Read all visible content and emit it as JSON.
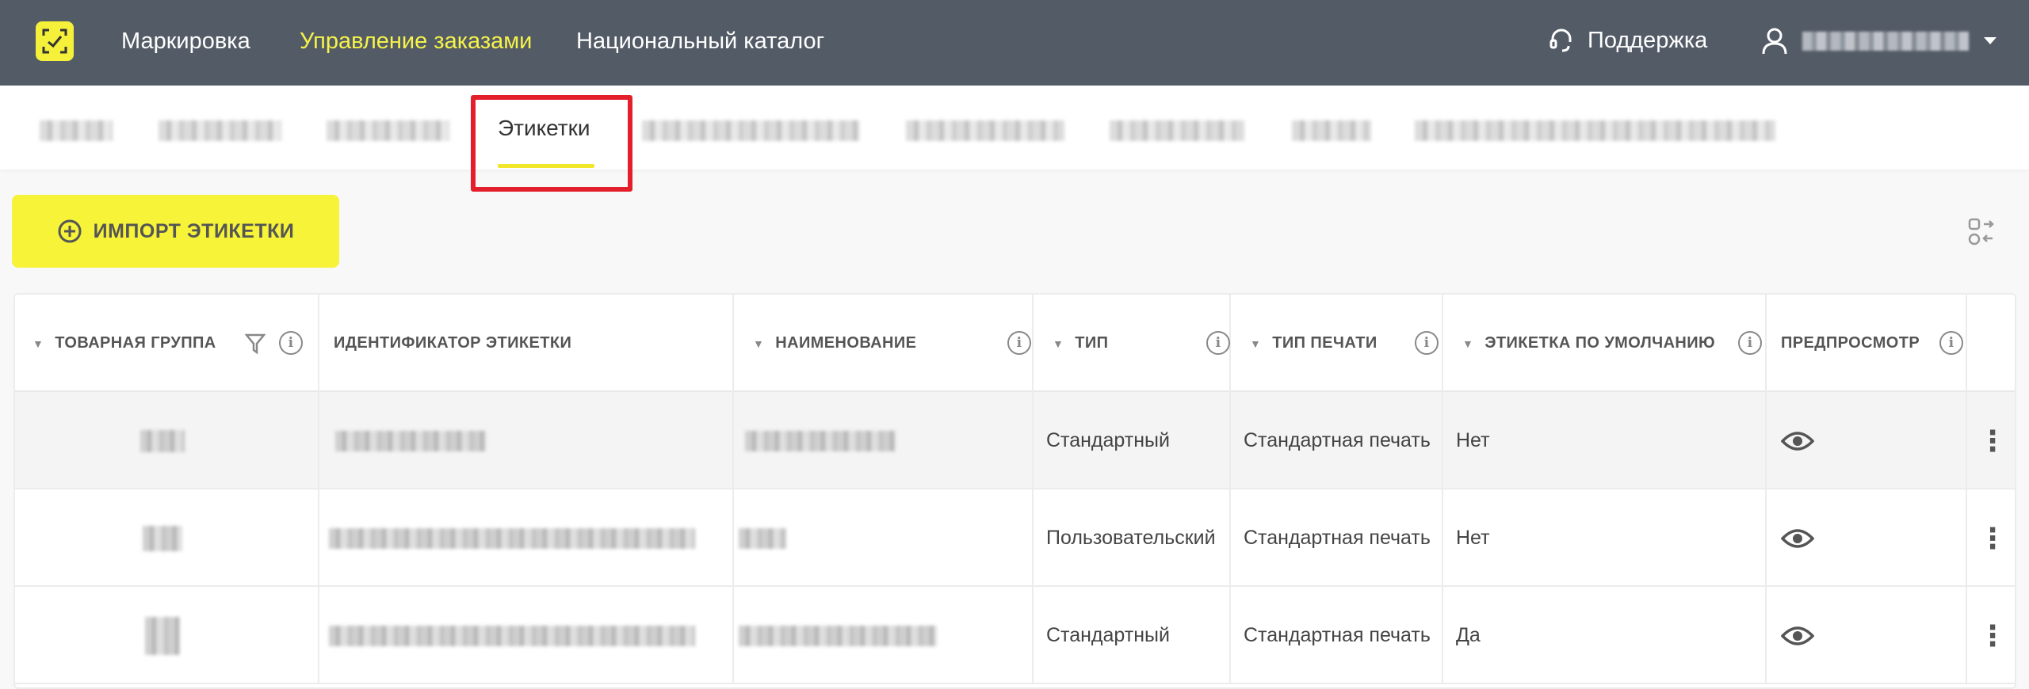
{
  "header": {
    "nav": [
      {
        "label": "Маркировка",
        "active": false
      },
      {
        "label": "Управление заказами",
        "active": true
      },
      {
        "label": "Национальный каталог",
        "active": false
      }
    ],
    "support_label": "Поддержка"
  },
  "subnav": {
    "active_tab": "Этикетки"
  },
  "toolbar": {
    "import_label": "ИМПОРТ ЭТИКЕТКИ"
  },
  "table": {
    "headers": [
      "ТОВАРНАЯ ГРУППА",
      "ИДЕНТИФИКАТОР ЭТИКЕТКИ",
      "НАИМЕНОВАНИЕ",
      "ТИП",
      "ТИП ПЕЧАТИ",
      "ЭТИКЕТКА ПО УМОЛЧАНИЮ",
      "ПРЕДПРОСМОТР"
    ],
    "rows": [
      {
        "type": "Стандартный",
        "print_type": "Стандартная печать",
        "default": "Нет"
      },
      {
        "type": "Пользовательский",
        "print_type": "Стандартная печать",
        "default": "Нет"
      },
      {
        "type": "Стандартный",
        "print_type": "Стандартная печать",
        "default": "Да"
      }
    ]
  },
  "colors": {
    "topbar": "#535b66",
    "accent": "#f6f338",
    "highlight": "#e41f2c"
  }
}
